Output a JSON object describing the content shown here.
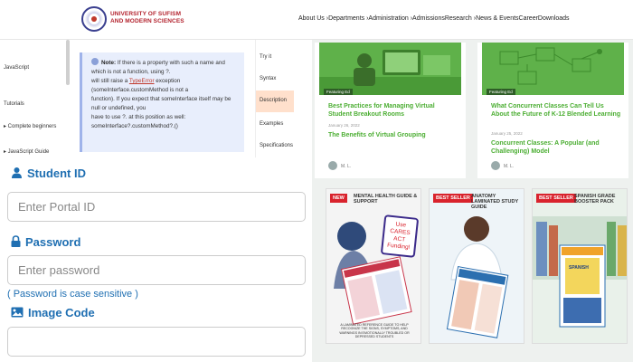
{
  "header": {
    "university_name_line1": "UNIVERSITY OF SUFISM",
    "university_name_line2": "AND MODERN SCIENCES",
    "nav": "About Us ›Departments ›Administration ›AdmissionsResearch ›News & EventsCareerDownloads"
  },
  "docs": {
    "sidebar": [
      "JavaScript",
      "Tutorials",
      "▸ Complete beginners",
      "▸ JavaScript Guide"
    ],
    "note_label": "Note:",
    "note_text_1": "If there is a property with such a name and which is not a function, using ?.",
    "note_text_2": "will still raise a",
    "note_code": "TypeError",
    "note_text_3": "exception (someInterface.customMethod is not a",
    "note_text_4": "function). If you expect that someInterface itself may be null or undefined, you",
    "note_text_5": "have to use ?. at this position as well: someInterface?.customMethod?.()",
    "right_links": [
      "Try it",
      "Syntax",
      "Description",
      "Examples",
      "Specifications"
    ]
  },
  "login": {
    "student_id_label": "Student ID",
    "student_id_placeholder": "Enter Portal ID",
    "password_label": "Password",
    "password_placeholder": "Enter password",
    "password_hint": "( Password is case sensitive )",
    "image_code_label": "Image Code",
    "image_code_placeholder": ""
  },
  "blog": [
    {
      "badge": "Featuring Ed",
      "title": "Best Practices for Managing Virtual Student Breakout Rooms",
      "date": "January 26, 2022",
      "subtitle": "The Benefits of Virtual Grouping",
      "author": "M. L."
    },
    {
      "badge": "Featuring Ed",
      "title": "What Concurrent Classes Can Tell Us About the Future of K-12 Blended Learning",
      "date": "January 25, 2022",
      "subtitle": "Concurrent Classes: A Popular (and Challenging) Model",
      "author": "M. L."
    }
  ],
  "products": [
    {
      "tag": "NEW",
      "title": "Mental Health Guide & Support",
      "sticker": "Use CARES ACT Funding!",
      "caption": "A LAMINATED REFERENCE GUIDE TO HELP RECOGNIZE THE SIGNS, SYMPTOMS, AND WARNINGS IN EMOTIONALLY TROUBLED OR DEPRESSED STUDENTS"
    },
    {
      "tag": "BEST SELLER",
      "title": "Anatomy Laminated Study Guide",
      "sticker": "",
      "caption": ""
    },
    {
      "tag": "BEST SELLER",
      "title": "Spanish Grade Booster Pack",
      "sticker": "SPANISH",
      "caption": ""
    }
  ],
  "colors": {
    "brand_blue": "#1f6fb2",
    "blog_green": "#4cae33",
    "university_red": "#b3232e",
    "badge_red": "#d9232d"
  }
}
